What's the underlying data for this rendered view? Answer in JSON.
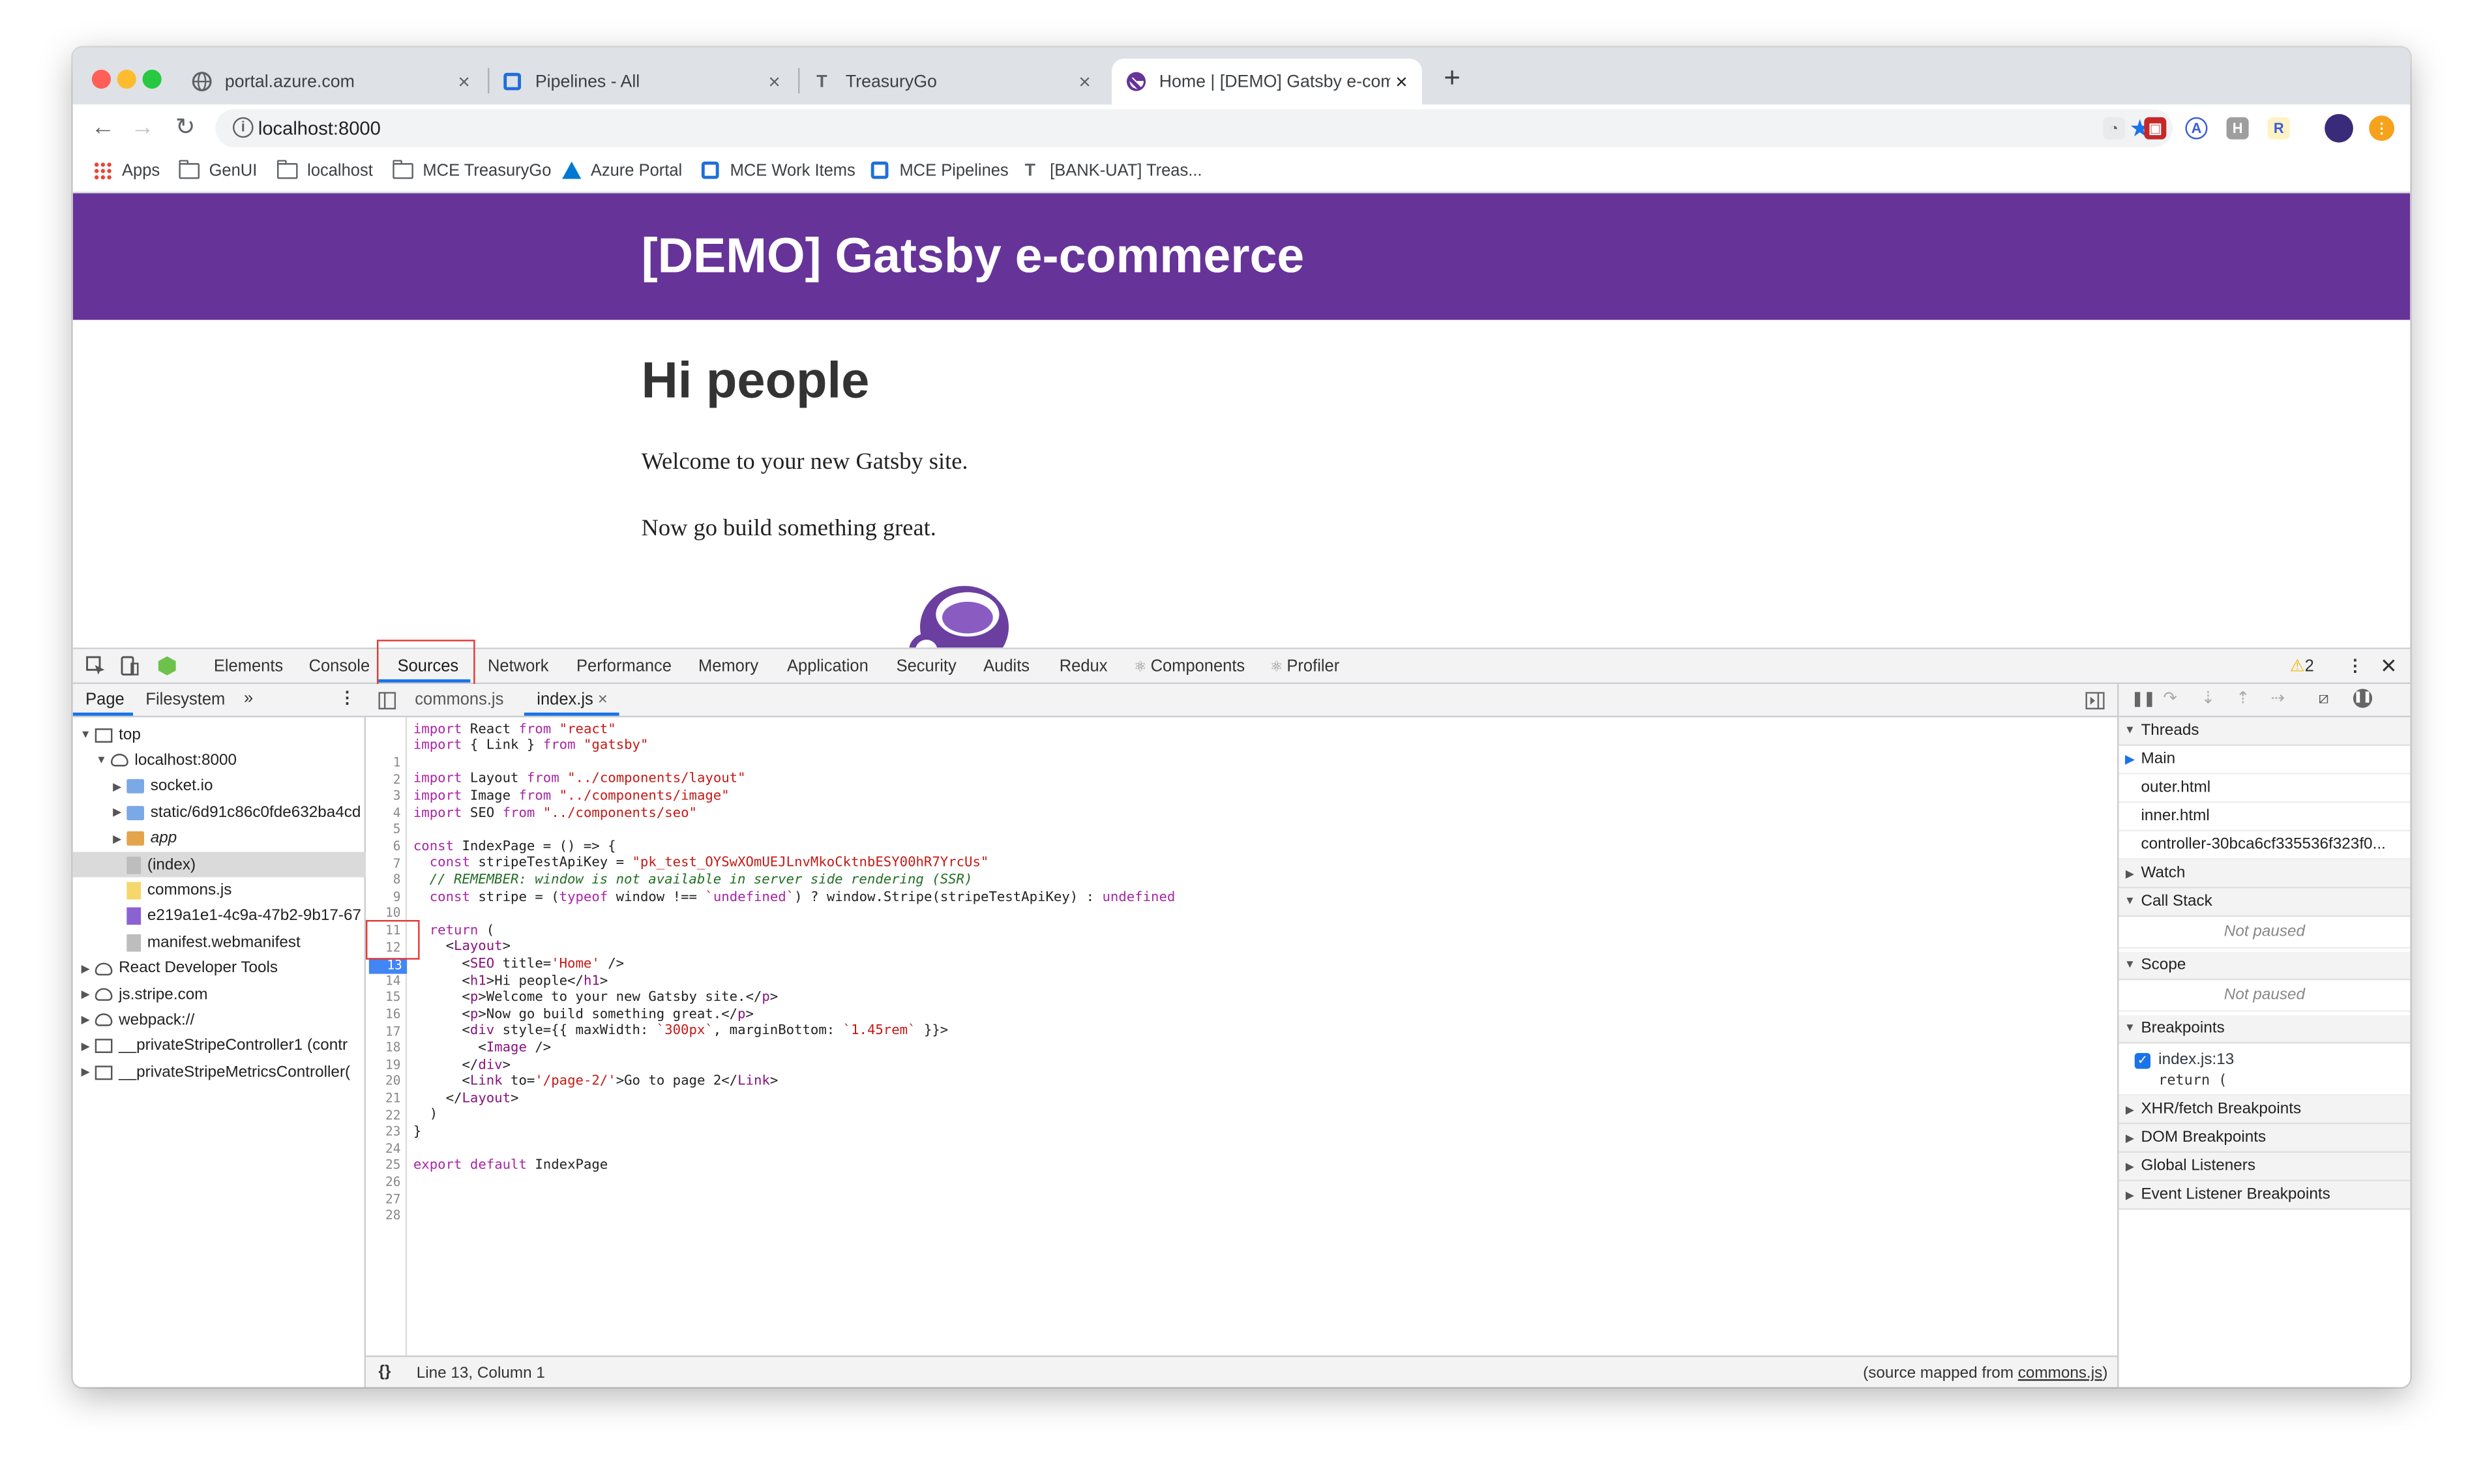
{
  "browser": {
    "tabs": [
      {
        "title": "portal.azure.com",
        "icon": "globe-icon"
      },
      {
        "title": "Pipelines - All",
        "icon": "azure-pipelines-icon"
      },
      {
        "title": "TreasuryGo",
        "icon": "treasurygo-icon"
      },
      {
        "title": "Home | [DEMO] Gatsby e-comm",
        "icon": "gatsby-icon",
        "active": true
      }
    ],
    "new_tab": "+",
    "address": "localhost:8000",
    "bookmarks": [
      {
        "label": "Apps",
        "icon": "apps-grid-icon"
      },
      {
        "label": "GenUI",
        "icon": "folder-icon"
      },
      {
        "label": "localhost",
        "icon": "folder-icon"
      },
      {
        "label": "MCE TreasuryGo",
        "icon": "folder-icon"
      },
      {
        "label": "Azure Portal",
        "icon": "azure-icon"
      },
      {
        "label": "MCE Work Items",
        "icon": "azure-devops-icon"
      },
      {
        "label": "MCE Pipelines",
        "icon": "azure-devops-icon"
      },
      {
        "label": "[BANK-UAT] Treas...",
        "icon": "treasurygo-icon"
      }
    ]
  },
  "site": {
    "header_title": "[DEMO] Gatsby e-commerce",
    "heading": "Hi people",
    "para1": "Welcome to your new Gatsby site.",
    "para2": "Now go build something great."
  },
  "devtools": {
    "tabs": [
      "Elements",
      "Console",
      "Sources",
      "Network",
      "Performance",
      "Memory",
      "Application",
      "Security",
      "Audits",
      "Redux",
      "Components",
      "Profiler"
    ],
    "active_tab": "Sources",
    "warnings": "2",
    "navigator_tabs": {
      "page": "Page",
      "filesystem": "Filesystem",
      "more": "»"
    },
    "tree": [
      {
        "label": "top",
        "icon": "frame-icon",
        "depth": 0,
        "expanded": true
      },
      {
        "label": "localhost:8000",
        "icon": "cloud-icon",
        "depth": 1,
        "expanded": true
      },
      {
        "label": "socket.io",
        "icon": "folder-icon",
        "depth": 2,
        "expanded": false
      },
      {
        "label": "static/6d91c86c0fde632ba4cd",
        "icon": "folder-icon",
        "depth": 2,
        "expanded": false
      },
      {
        "label": "app",
        "icon": "folder-icon",
        "depth": 2,
        "expanded": false
      },
      {
        "label": "(index)",
        "icon": "file-icon",
        "depth": 2,
        "selected": true
      },
      {
        "label": "commons.js",
        "icon": "js-file-icon",
        "depth": 2
      },
      {
        "label": "e219a1e1-4c9a-47b2-9b17-67",
        "icon": "file-icon",
        "depth": 2
      },
      {
        "label": "manifest.webmanifest",
        "icon": "file-icon",
        "depth": 2
      },
      {
        "label": "React Developer Tools",
        "icon": "cloud-icon",
        "depth": 0
      },
      {
        "label": "js.stripe.com",
        "icon": "cloud-icon",
        "depth": 0
      },
      {
        "label": "webpack://",
        "icon": "cloud-icon",
        "depth": 0
      },
      {
        "label": "__privateStripeController1 (contr",
        "icon": "frame-icon",
        "depth": 0
      },
      {
        "label": "__privateStripeMetricsController(",
        "icon": "frame-icon",
        "depth": 0
      }
    ],
    "editor_tabs": [
      "commons.js",
      "index.js"
    ],
    "code_lines": [
      "import React from \"react\"",
      "import { Link } from \"gatsby\"",
      "",
      "import Layout from \"../components/layout\"",
      "import Image from \"../components/image\"",
      "import SEO from \"../components/seo\"",
      "",
      "const IndexPage = () => {",
      "  const stripeTestApiKey = \"pk_test_OYSwXOmUEJLnvMkoCktnbESY00hR7YrcUs\"",
      "  // REMEMBER: window is not available in server side rendering (SSR)",
      "  const stripe = (typeof window !== `undefined`) ? window.Stripe(stripeTestApiKey) : undefined",
      "",
      "  return (",
      "    <Layout>",
      "      <SEO title='Home' />",
      "      <h1>Hi people</h1>",
      "      <p>Welcome to your new Gatsby site.</p>",
      "      <p>Now go build something great.</p>",
      "      <div style={{ maxWidth: `300px`, marginBottom: `1.45rem` }}>",
      "        <Image />",
      "      </div>",
      "      <Link to='/page-2/'>Go to page 2</Link>",
      "    </Layout>",
      "  )",
      "}",
      "",
      "export default IndexPage",
      ""
    ],
    "breakpoint_line": "13",
    "status_left": "Line 13, Column 1",
    "status_right_prefix": "(source mapped from ",
    "status_right_link": "commons.js",
    "status_right_suffix": ")",
    "status_braces": "{}",
    "sidebar": {
      "threads_label": "Threads",
      "threads": [
        "Main",
        "outer.html",
        "inner.html",
        "controller-30bca6cf335536f323f0..."
      ],
      "watch_label": "Watch",
      "callstack_label": "Call Stack",
      "callstack_empty": "Not paused",
      "scope_label": "Scope",
      "scope_empty": "Not paused",
      "breakpoints_label": "Breakpoints",
      "breakpoint_file": "index.js:13",
      "breakpoint_code": "return (",
      "xhr_label": "XHR/fetch Breakpoints",
      "dom_label": "DOM Breakpoints",
      "global_label": "Global Listeners",
      "event_label": "Event Listener Breakpoints"
    }
  },
  "colors": {
    "gatsby_purple": "#663399",
    "chrome_frame": "#dee1e6",
    "highlight_red": "#e53935",
    "breakpoint_blue": "#4285f4"
  }
}
